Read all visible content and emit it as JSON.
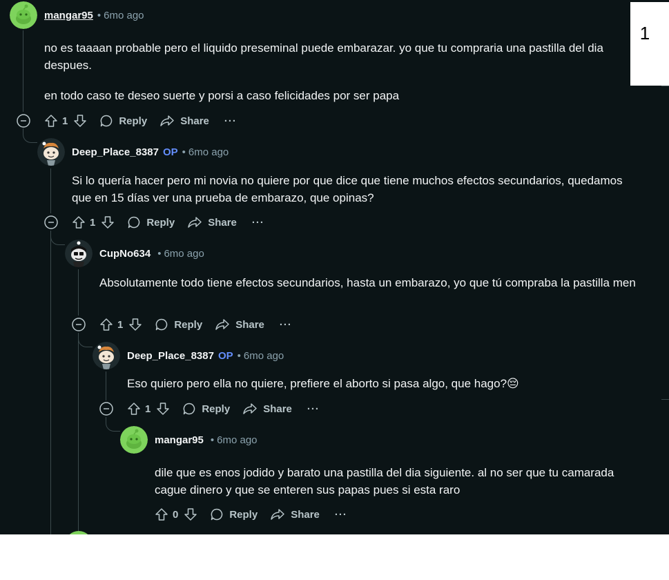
{
  "comments": [
    {
      "author": "mangar95",
      "op_badge": "",
      "time": "6mo ago",
      "paragraphs": [
        "no es taaaan probable pero el liquido preseminal puede embarazar. yo que tu compraria una pastilla del dia despues.",
        "en todo caso te deseo suerte y porsi a caso felicidades por ser papa"
      ],
      "votes": "1",
      "avatar": "snoo-green-avatar"
    },
    {
      "author": "Deep_Place_8387",
      "op_badge": "OP",
      "time": "6mo ago",
      "paragraphs": [
        "Si lo quería hacer pero mi novia no quiere por que dice que tiene muchos efectos secundarios, quedamos que en 15 días ver una prueba de embarazo, que opinas?"
      ],
      "votes": "1",
      "avatar": "snoo-chef-avatar"
    },
    {
      "author": "CupNo634",
      "op_badge": "",
      "time": "6mo ago",
      "paragraphs": [
        "Absolutamente todo tiene efectos secundarios, hasta un embarazo, yo que tú compraba la pastilla men"
      ],
      "votes": "1",
      "avatar": "snoo-dark-avatar"
    },
    {
      "author": "Deep_Place_8387",
      "op_badge": "OP",
      "time": "6mo ago",
      "paragraphs": [
        "Eso quiero pero ella no quiere, prefiere el aborto si pasa algo, que hago?😔"
      ],
      "votes": "1",
      "avatar": "snoo-chef-avatar"
    },
    {
      "author": "mangar95",
      "op_badge": "",
      "time": "6mo ago",
      "paragraphs": [
        "dile que es enos jodido y barato una pastilla del dia siguiente. al no ser que tu camarada cague dinero y que se enteren sus papas pues si esta raro"
      ],
      "votes": "0",
      "avatar": "snoo-green-avatar"
    }
  ],
  "actions": {
    "reply": "Reply",
    "share": "Share",
    "more": "···"
  },
  "separator": "•",
  "overlay": {
    "number": "1"
  },
  "colors": {
    "background": "#0b1416",
    "text": "#f2f4f5",
    "meta": "#8ba2ad",
    "op": "#648efc",
    "thread_line": "#3c4a4d"
  }
}
